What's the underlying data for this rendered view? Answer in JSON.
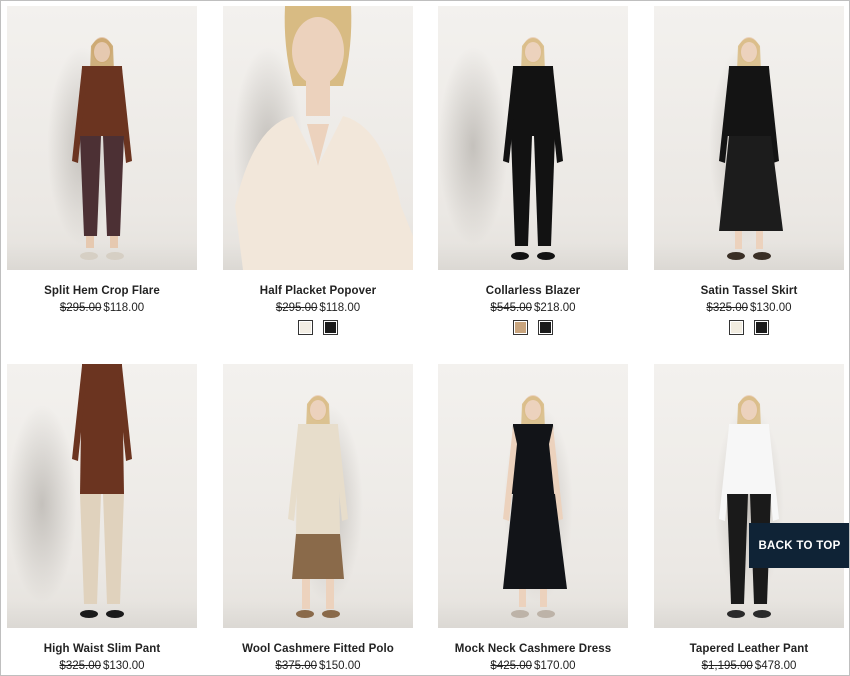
{
  "products": [
    {
      "name": "Split Hem Crop Flare",
      "original_price": "$295.00",
      "sale_price": "$118.00",
      "swatches": [],
      "outfit": {
        "skin": "#e6c9b0",
        "hair": "#c9a46a",
        "top": "#6b3420",
        "bottom": "#4c3034",
        "shoes": "#d6cfc4",
        "top_style": "turtleneck",
        "bottom_style": "crop-pant"
      }
    },
    {
      "name": "Half Placket Popover",
      "original_price": "$295.00",
      "sale_price": "$118.00",
      "swatches": [
        "#f3eee4",
        "#1b1b1b"
      ],
      "outfit": {
        "skin": "#ecd2bd",
        "hair": "#d8bb83",
        "top": "#f2e7da",
        "bottom": "#f2e7da",
        "shoes": "#f2e7da",
        "top_style": "closeup",
        "bottom_style": "none"
      }
    },
    {
      "name": "Collarless Blazer",
      "original_price": "$545.00",
      "sale_price": "$218.00",
      "swatches": [
        "#c9a57e",
        "#1b1b1b"
      ],
      "outfit": {
        "skin": "#ecd2bd",
        "hair": "#d8bb83",
        "top": "#121212",
        "bottom": "#121212",
        "shoes": "#121212",
        "top_style": "blazer",
        "bottom_style": "pant"
      }
    },
    {
      "name": "Satin Tassel Skirt",
      "original_price": "$325.00",
      "sale_price": "$130.00",
      "swatches": [
        "#f1ece0",
        "#1b1b1b"
      ],
      "outfit": {
        "skin": "#ecd2bd",
        "hair": "#d8bb83",
        "top": "#141414",
        "bottom": "#1c1c1c",
        "shoes": "#3a2f26",
        "top_style": "blouse",
        "bottom_style": "skirt"
      }
    },
    {
      "name": "High Waist Slim Pant",
      "original_price": "$325.00",
      "sale_price": "$130.00",
      "swatches": [],
      "outfit": {
        "skin": "#e6c9b0",
        "hair": "#c9a46a",
        "top": "#6b3420",
        "bottom": "#e0d2bd",
        "shoes": "#1b1b1b",
        "top_style": "cropped",
        "bottom_style": "pant"
      }
    },
    {
      "name": "Wool Cashmere Fitted Polo",
      "original_price": "$375.00",
      "sale_price": "$150.00",
      "swatches": [],
      "outfit": {
        "skin": "#ecd2bd",
        "hair": "#d8bb83",
        "top": "#e7ddcb",
        "bottom": "#8a6a4a",
        "shoes": "#8a6a4a",
        "top_style": "polo",
        "bottom_style": "short-skirt"
      }
    },
    {
      "name": "Mock Neck Cashmere Dress",
      "original_price": "$425.00",
      "sale_price": "$170.00",
      "swatches": [],
      "outfit": {
        "skin": "#ecd2bd",
        "hair": "#d8bb83",
        "top": "#121418",
        "bottom": "#121418",
        "shoes": "#bdb3a8",
        "top_style": "sleeveless",
        "bottom_style": "dress"
      }
    },
    {
      "name": "Tapered Leather Pant",
      "original_price": "$1,195.00",
      "sale_price": "$478.00",
      "swatches": [],
      "outfit": {
        "skin": "#ecd2bd",
        "hair": "#d8bb83",
        "top": "#f7f7f7",
        "bottom": "#1a1a1a",
        "shoes": "#2a2a2a",
        "top_style": "shirt",
        "bottom_style": "pant"
      }
    }
  ],
  "back_to_top": "BACK TO TOP"
}
